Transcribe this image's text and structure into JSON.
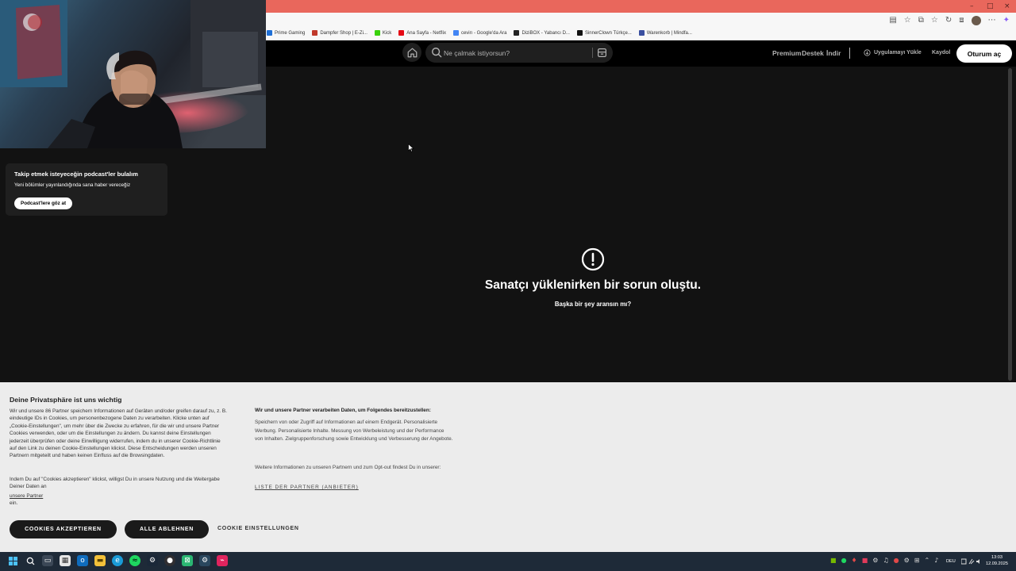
{
  "browser": {
    "bookmarks": [
      {
        "label": "Prime Gaming",
        "color": "#1f6fd6"
      },
      {
        "label": "Dampfer Shop | E-Zi...",
        "color": "#c0392b"
      },
      {
        "label": "Kick",
        "color": "#39d10b"
      },
      {
        "label": "Ana Sayfa - Netflix",
        "color": "#e50914"
      },
      {
        "label": "cevirı - Google'da Ara",
        "color": "#4285f4"
      },
      {
        "label": "DiziBOX - Yabancı D...",
        "color": "#222222"
      },
      {
        "label": "SinnerClown Türkçe...",
        "color": "#111111"
      },
      {
        "label": "Warenkorb | Mindfa...",
        "color": "#3a4fa0"
      }
    ]
  },
  "spotify": {
    "search_placeholder": "Ne çalmak istiyorsun?",
    "nav": {
      "premium": "Premium",
      "support": "Destek",
      "download": "İndir",
      "install_app": "Uygulamayı Yükle",
      "signup": "Kaydol",
      "login": "Oturum aç"
    },
    "sidebar": {
      "podcast_title": "Takip etmek isteyeceğin podcast'ler bulalım",
      "podcast_sub": "Yeni bölümler yayınlandığında sana haber vereceğiz",
      "podcast_button": "Podcast'lere göz at"
    },
    "error": {
      "title": "Sanatçı yüklenirken bir sorun oluştu.",
      "subtitle": "Başka bir şey aransın mı?"
    }
  },
  "cookie": {
    "title": "Deine Privatsphäre ist uns wichtig",
    "body": "Wir und unsere 86 Partner speichern Informationen auf Geräten und/oder greifen darauf zu, z. B. eindeutige IDs in Cookies, um personenbezogene Daten zu verarbeiten. Klicke unten auf „Cookie-Einstellungen\", um mehr über die Zwecke zu erfahren, für die wir und unsere Partner Cookies verwenden, oder um die Einstellungen zu ändern. Du kannst deine Einstellungen jederzeit überprüfen oder deine Einwilligung widerrufen, indem du in unserer Cookie-Richtlinie auf den Link zu deinen Cookie-Einstellungen klickst. Diese Entscheidungen werden unseren Partnern mitgeteilt und haben keinen Einfluss auf die Browsingdaten.",
    "body2": "Indem Du auf \"Cookies akzeptieren\" klickst, willigst Du in unsere Nutzung und die Weitergabe Deiner Daten an",
    "partners_link": "unsere Partner",
    "ein": "ein.",
    "right_heading": "Wir und unsere Partner verarbeiten Daten, um Folgendes bereitzustellen:",
    "right_body1": "Speichern von oder Zugriff auf Informationen auf einem Endgerät. Personalisierte Werbung. Personalisierte Inhalte. Messung von Werbeleistung und der Performance von Inhalten. Zielgruppenforschung sowie Entwicklung und Verbesserung der Angebote.",
    "right_body2": "Weitere Informationen zu unseren Partnern und zum Opt-out findest Du in unserer:",
    "partner_list_link": "LISTE DER PARTNER (ANBIETER)",
    "accept_button": "COOKIES AKZEPTIEREN",
    "reject_button": "ALLE ABLEHNEN",
    "settings_button": "COOKIE EINSTELLUNGEN"
  },
  "taskbar": {
    "language": "DEU",
    "time": "13:03",
    "date": "12.09.2025"
  },
  "colors": {
    "titlebar": "#e9675c",
    "spotify_bg": "#121212",
    "spotify_black": "#000000",
    "card": "#1f1f1f",
    "cookie_bg": "#ececec",
    "taskbar": "#1e2a38"
  }
}
